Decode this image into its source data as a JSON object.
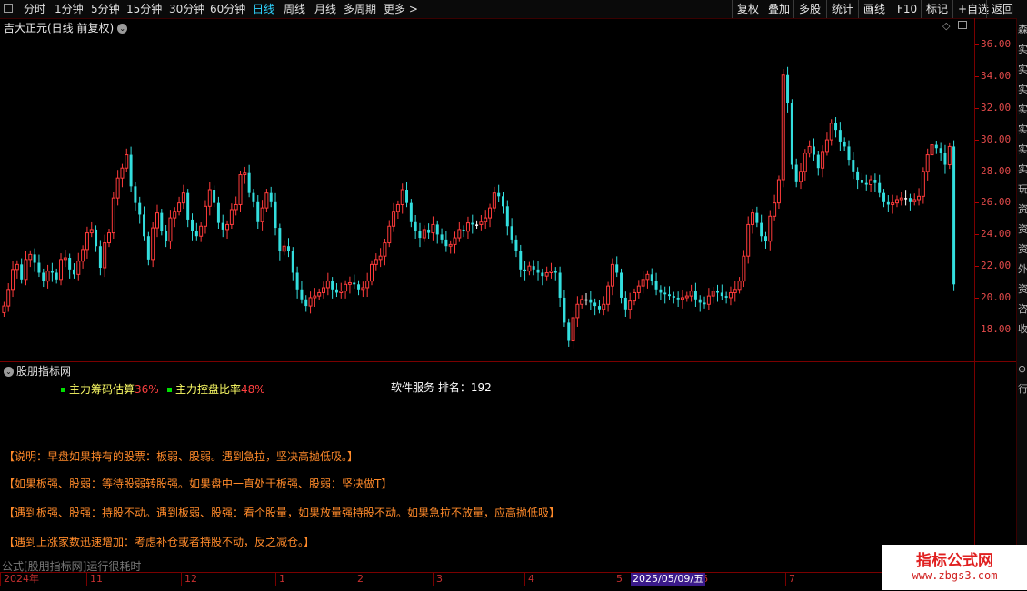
{
  "toolbar": {
    "periods": [
      "分时",
      "1分钟",
      "5分钟",
      "15分钟",
      "30分钟",
      "60分钟",
      "日线",
      "周线",
      "月线",
      "多周期",
      "更多 >"
    ],
    "active_period": "日线",
    "buttons": [
      "复权",
      "叠加",
      "多股",
      "统计",
      "画线",
      "F10",
      "标记",
      "+自选",
      "返回"
    ]
  },
  "main_chart": {
    "title": "吉大正元(日线 前复权)",
    "price_ticks": [
      "36.00",
      "34.00",
      "32.00",
      "30.00",
      "28.00",
      "26.00",
      "24.00",
      "22.00",
      "20.00",
      "18.00"
    ]
  },
  "indicator": {
    "title": "股朋指标网",
    "legend": [
      {
        "label": "主力筹码估算",
        "value": "36%"
      },
      {
        "label": "主力控盘比率",
        "value": "48%"
      }
    ],
    "software_rank": "软件服务 排名：192",
    "notes": [
      "【说明：早盘如果持有的股票：板弱、股弱。遇到急拉，坚决高抛低吸。】",
      "【如果板强、股弱：等待股弱转股强。如果盘中一直处于板强、股弱：坚决做T】",
      "【遇到板强、股强：持股不动。遇到板弱、股强：看个股量，如果放量强持股不动。如果急拉不放量，应高抛低吸】",
      "【遇到上涨家数迅速增加：考虑补仓或者持股不动，反之减仓。】"
    ]
  },
  "status_text": "公式[股朋指标网]运行很耗时",
  "date_axis": {
    "labels": [
      "2024年",
      "11",
      "12",
      "1",
      "2",
      "3",
      "4",
      "5",
      "6",
      "7"
    ],
    "cursor": "2025/05/09/五"
  },
  "right_strip_chars": [
    "森",
    "实",
    "实",
    "实",
    "实",
    "实",
    "实",
    "实",
    "玩",
    "资",
    "资",
    "资",
    "外",
    "资",
    "咨",
    "收"
  ],
  "right_strip_bottom": [
    "⊕",
    "行"
  ],
  "logo": {
    "title": "指标公式网",
    "url": "www.zbgs3.com"
  },
  "colors": {
    "up": "#ff3b3b",
    "down": "#33dede",
    "doji": "#ffffff",
    "axis": "#e34a4a"
  },
  "chart_data": {
    "type": "candlestick",
    "title": "吉大正元(日线 前复权)",
    "ylim": [
      17,
      37
    ],
    "y_ticks": [
      18,
      20,
      22,
      24,
      26,
      28,
      30,
      32,
      34,
      36
    ],
    "x_labels": [
      "2024年",
      "11",
      "12",
      "1",
      "2",
      "3",
      "4",
      "5",
      "6",
      "7"
    ],
    "closes": [
      20.0,
      21.0,
      22.2,
      22.5,
      21.6,
      22.8,
      23.1,
      22.6,
      22.0,
      21.5,
      22.1,
      22.0,
      21.6,
      22.8,
      22.9,
      22.2,
      21.9,
      22.7,
      23.4,
      24.4,
      24.6,
      23.6,
      22.3,
      23.8,
      24.4,
      26.5,
      27.7,
      28.3,
      29.1,
      27.2,
      26.2,
      25.5,
      24.2,
      22.8,
      24.7,
      25.6,
      24.5,
      23.9,
      25.3,
      25.7,
      26.2,
      26.8,
      25.2,
      24.5,
      24.2,
      24.8,
      26.0,
      27.0,
      26.2,
      25.0,
      24.6,
      24.9,
      25.8,
      26.1,
      27.9,
      28.0,
      26.8,
      26.3,
      25.1,
      25.9,
      26.8,
      26.3,
      24.7,
      23.3,
      23.6,
      23.3,
      22.0,
      21.0,
      20.4,
      20.0,
      20.5,
      20.6,
      20.8,
      21.1,
      21.5,
      21.0,
      20.8,
      20.9,
      21.3,
      21.4,
      21.3,
      21.0,
      21.1,
      21.5,
      22.5,
      22.8,
      23.0,
      23.8,
      24.8,
      25.7,
      26.1,
      27.0,
      26.2,
      25.1,
      24.5,
      24.1,
      24.6,
      24.4,
      24.9,
      24.3,
      24.0,
      23.6,
      23.7,
      24.1,
      24.6,
      24.5,
      25.0,
      24.9,
      24.9,
      25.1,
      25.3,
      25.9,
      26.8,
      26.6,
      26.0,
      24.8,
      24.0,
      23.3,
      22.2,
      22.1,
      22.4,
      22.2,
      22.0,
      21.8,
      22.0,
      22.1,
      22.0,
      20.5,
      19.0,
      17.9,
      19.3,
      20.1,
      20.4,
      20.4,
      20.2,
      20.0,
      19.8,
      20.1,
      21.2,
      22.5,
      22.0,
      20.5,
      19.8,
      20.3,
      20.8,
      21.2,
      21.6,
      21.9,
      21.5,
      21.0,
      20.8,
      20.7,
      20.6,
      20.5,
      20.4,
      20.5,
      20.6,
      20.9,
      20.4,
      20.2,
      20.1,
      20.6,
      20.9,
      20.8,
      20.6,
      20.5,
      20.8,
      21.0,
      21.5,
      23.0,
      24.9,
      25.6,
      25.0,
      24.2,
      23.9,
      25.4,
      26.2,
      27.6,
      33.9,
      32.2,
      28.5,
      27.5,
      28.1,
      29.2,
      29.6,
      29.1,
      28.3,
      29.3,
      30.0,
      31.0,
      30.6,
      29.9,
      29.6,
      28.8,
      28.1,
      27.6,
      27.4,
      27.3,
      27.6,
      27.4,
      26.8,
      26.3,
      26.1,
      26.2,
      26.4,
      26.5,
      26.5,
      26.3,
      26.4,
      26.6,
      28.1,
      29.1,
      29.7,
      29.5,
      29.2,
      28.5,
      29.6,
      21.3
    ]
  }
}
